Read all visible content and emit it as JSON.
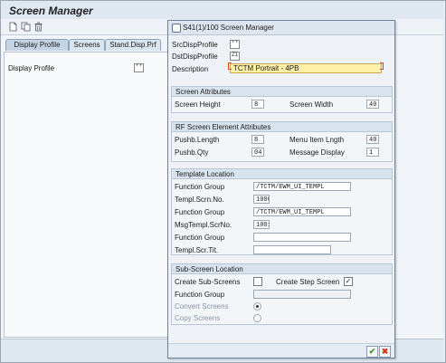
{
  "app": {
    "title": "Screen Manager"
  },
  "toolbar": {
    "icons": [
      "new-document-icon",
      "copy-icon",
      "delete-icon"
    ]
  },
  "tabs": [
    {
      "label": "Display Profile",
      "active": true
    },
    {
      "label": "Screens",
      "active": false
    },
    {
      "label": "Stand.Disp.Prf",
      "active": false
    }
  ],
  "main": {
    "display_profile_label": "Display Profile",
    "display_profile_value": "* *"
  },
  "dialog": {
    "title": "S41(1)/100 Screen Manager",
    "fields": {
      "src_disp_profile": {
        "label": "SrcDispProfile",
        "value": "* *"
      },
      "dst_disp_profile": {
        "label": "DstDispProfile",
        "value": "Z1"
      },
      "description": {
        "label": "Description",
        "value": "TCTM Portrait - 4PB"
      }
    },
    "screen_attributes": {
      "title": "Screen Attributes",
      "height_label": "Screen Height",
      "height_value": "8",
      "width_label": "Screen Width",
      "width_value": "40"
    },
    "rf_attributes": {
      "title": "RF Screen Element Attributes",
      "pushb_length_label": "Pushb.Length",
      "pushb_length_value": "8",
      "menu_item_label": "Menu Item Lngth",
      "menu_item_value": "40",
      "pushb_qty_label": "Pushb.Qty",
      "pushb_qty_value": "04",
      "message_display_label": "Message Display",
      "message_display_value": "1"
    },
    "template_location": {
      "title": "Template Location",
      "rows": [
        {
          "label": "Function Group",
          "value": "/TCTM/EWM_UI_TEMPL"
        },
        {
          "label": "Templ.Scrn.No.",
          "value": "1000"
        },
        {
          "label": "Function Group",
          "value": "/TCTM/EWM_UI_TEMPL"
        },
        {
          "label": "MsgTempl.ScrNo.",
          "value": "1001"
        },
        {
          "label": "Function Group",
          "value": ""
        },
        {
          "label": "Templ.Scr.Tit.",
          "value": ""
        }
      ]
    },
    "subscreen_location": {
      "title": "Sub-Screen Location",
      "create_subscreens_label": "Create Sub-Screens",
      "create_step_screen_label": "Create Step Screen",
      "create_step_screen_checked": "✓",
      "function_group_label": "Function Group",
      "function_group_value": "",
      "convert_screens_label": "Convert Screens",
      "copy_screens_label": "Copy Screens"
    },
    "buttons": {
      "ok": "✔",
      "cancel": "✖"
    },
    "colors": {
      "ok": "#3a9a2a",
      "cancel": "#d03a1a",
      "description_bg": "#fff2a8"
    }
  }
}
